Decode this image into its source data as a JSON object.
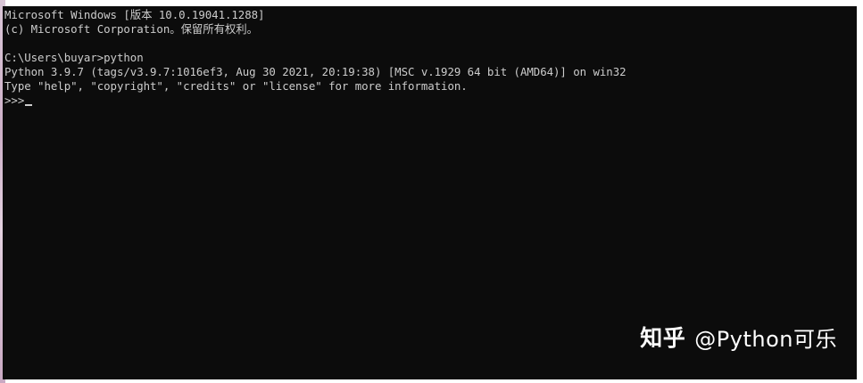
{
  "terminal": {
    "lines": [
      "Microsoft Windows [版本 10.0.19041.1288]",
      "(c) Microsoft Corporation。保留所有权利。",
      "",
      "C:\\Users\\buyar>python",
      "Python 3.9.7 (tags/v3.9.7:1016ef3, Aug 30 2021, 20:19:38) [MSC v.1929 64 bit (AMD64)] on win32",
      "Type \"help\", \"copyright\", \"credits\" or \"license\" for more information."
    ],
    "prompt": ">>>"
  },
  "watermark": {
    "logo": "知乎",
    "handle": "@Python可乐"
  },
  "colors": {
    "console_background": "#0c0c0c",
    "console_text": "#cccccc",
    "watermark_text": "#ffffff"
  }
}
